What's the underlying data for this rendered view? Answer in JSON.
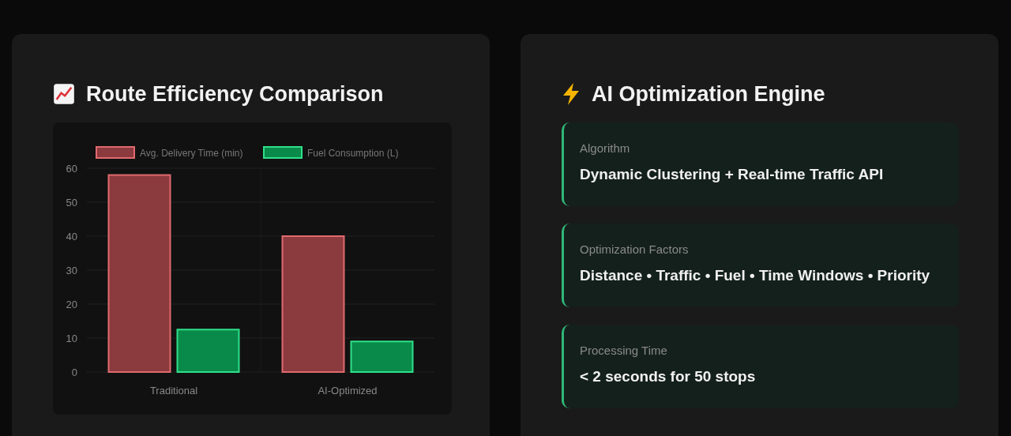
{
  "chart_panel": {
    "title": "Route Efficiency Comparison",
    "chart_data": {
      "type": "bar",
      "categories": [
        "Traditional",
        "AI-Optimized"
      ],
      "series": [
        {
          "name": "Avg. Delivery Time (min)",
          "color": "#8b3a3e",
          "values": [
            58,
            40
          ]
        },
        {
          "name": "Fuel Consumption (L)",
          "color": "#0a8a4a",
          "values": [
            12.5,
            9
          ]
        }
      ],
      "ylim": [
        0,
        60
      ],
      "grid": true,
      "legend": "top",
      "yticks": [
        0,
        10,
        20,
        30,
        40,
        50,
        60
      ]
    }
  },
  "engine_panel": {
    "title": "AI Optimization Engine",
    "items": [
      {
        "label": "Algorithm",
        "value": "Dynamic Clustering + Real-time Traffic API"
      },
      {
        "label": "Optimization Factors",
        "value": "Distance • Traffic • Fuel • Time Windows • Priority"
      },
      {
        "label": "Processing Time",
        "value": "< 2 seconds for 50 stops"
      }
    ]
  }
}
